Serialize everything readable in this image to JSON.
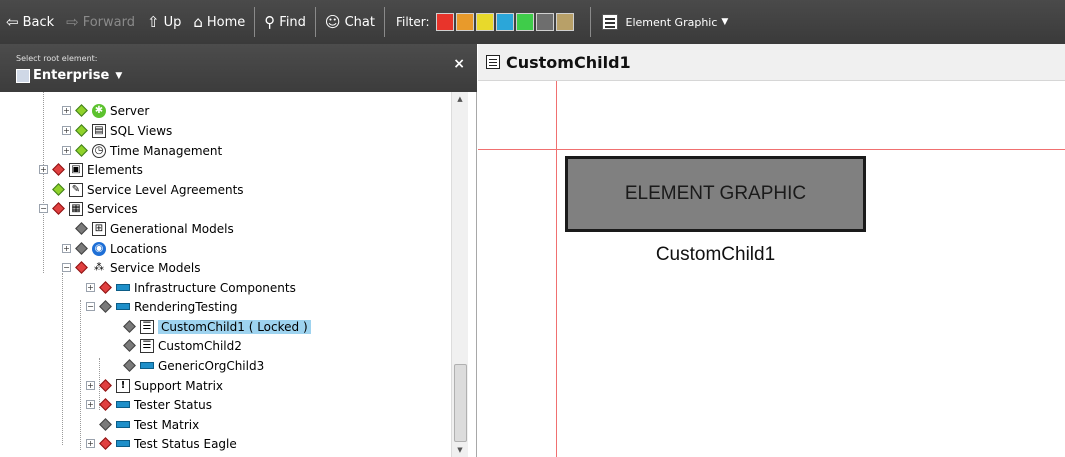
{
  "toolbar": {
    "back": "Back",
    "forward": "Forward",
    "up": "Up",
    "home": "Home",
    "find": "Find",
    "chat": "Chat",
    "filter_label": "Filter:",
    "filter_colors": [
      "#e8342b",
      "#e89a2b",
      "#e8d92b",
      "#2ba6d9",
      "#3fcc4a",
      "#6e6e6e",
      "#b8a068"
    ],
    "view_mode": "Element Graphic"
  },
  "sidebar": {
    "root_label": "Select root element:",
    "root_value": "Enterprise",
    "tree": [
      {
        "label": "Server",
        "icon": "gear-icon",
        "status": "green"
      },
      {
        "label": "SQL Views",
        "icon": "sql-views-icon",
        "status": "green"
      },
      {
        "label": "Time Management",
        "icon": "clock-icon",
        "status": "green"
      },
      {
        "label": "Elements",
        "icon": "elements-icon",
        "status": "red"
      },
      {
        "label": "Service Level Agreements",
        "icon": "sla-icon",
        "status": "green"
      },
      {
        "label": "Services",
        "icon": "services-icon",
        "status": "red"
      },
      {
        "label": "Generational Models",
        "icon": "grid-icon",
        "status": "gray"
      },
      {
        "label": "Locations",
        "icon": "globe-icon",
        "status": "gray"
      },
      {
        "label": "Service Models",
        "icon": "hierarchy-icon",
        "status": "red"
      },
      {
        "label": "Infrastructure Components",
        "icon": "component-icon",
        "status": "red"
      },
      {
        "label": "RenderingTesting",
        "icon": "component-icon",
        "status": "gray"
      },
      {
        "label": "CustomChild1 ( Locked )",
        "icon": "database-icon",
        "status": "gray"
      },
      {
        "label": "CustomChild2",
        "icon": "database-icon",
        "status": "gray"
      },
      {
        "label": "GenericOrgChild3",
        "icon": "component-icon",
        "status": "gray"
      },
      {
        "label": "Support Matrix",
        "icon": "warning-icon",
        "status": "red"
      },
      {
        "label": "Tester Status",
        "icon": "component-icon",
        "status": "red"
      },
      {
        "label": "Test Matrix",
        "icon": "component-icon",
        "status": "gray"
      },
      {
        "label": "Test Status Eagle",
        "icon": "component-icon",
        "status": "red"
      }
    ]
  },
  "main": {
    "title": "CustomChild1",
    "graphic_text": "ELEMENT GRAPHIC",
    "graphic_caption": "CustomChild1"
  }
}
